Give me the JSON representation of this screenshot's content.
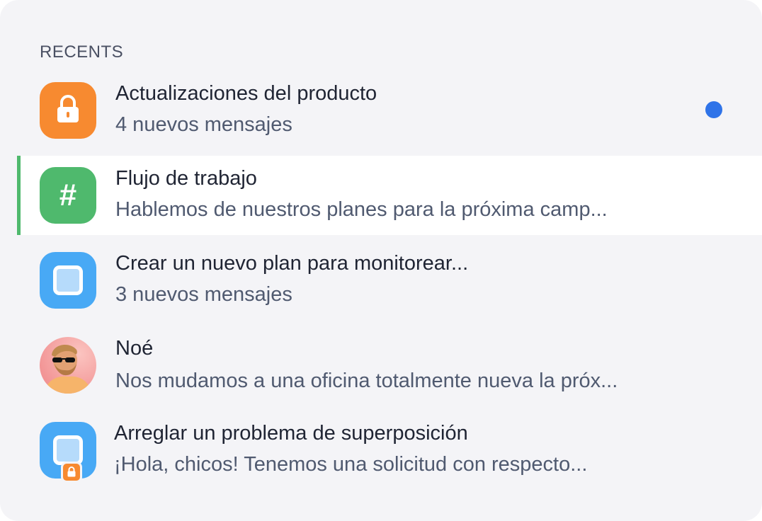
{
  "recents": {
    "title": "RECENTS",
    "items": [
      {
        "icon": "lock-icon",
        "title": "Actualizaciones del producto",
        "subtitle": "4 nuevos mensajes",
        "unread": true
      },
      {
        "icon": "hash-icon",
        "title": "Flujo de trabajo",
        "subtitle": "Hablemos de nuestros planes para la próxima camp...",
        "active": true
      },
      {
        "icon": "square-icon",
        "title": "Crear un nuevo plan para monitorear...",
        "subtitle": "3 nuevos mensajes"
      },
      {
        "icon": "avatar",
        "title": "Noé",
        "subtitle": "Nos mudamos a una oficina totalmente nueva la próx..."
      },
      {
        "icon": "square-icon",
        "badge": "lock-badge-icon",
        "title": "Arreglar un problema de superposición",
        "subtitle": "¡Hola, chicos! Tenemos una solicitud con respecto..."
      }
    ]
  },
  "colors": {
    "panel_bg": "#f4f4f7",
    "active_bar": "#4fb96d",
    "orange": "#f78a30",
    "green": "#4fb96d",
    "blue": "#48a9f5",
    "unread_dot": "#2f73e8"
  }
}
